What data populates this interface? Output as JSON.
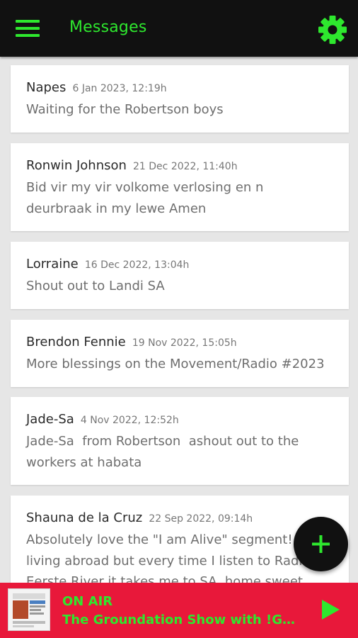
{
  "header": {
    "title": "Messages",
    "menu_icon": "hamburger-menu-icon",
    "settings_icon": "gear-icon",
    "accent_color": "#2ee82e",
    "bar_color": "#111111"
  },
  "messages": [
    {
      "name": "Napes",
      "date": "6 Jan 2023, 12:19h",
      "text": "Waiting for the Robertson boys"
    },
    {
      "name": "Ronwin Johnson",
      "date": "21 Dec 2022, 11:40h",
      "text": "Bid vir my vir volkome verlosing en n\ndeurbraak in my lewe Amen"
    },
    {
      "name": "Lorraine",
      "date": "16 Dec 2022, 13:04h",
      "text": "Shout out to Landi SA"
    },
    {
      "name": "Brendon Fennie",
      "date": "19 Nov 2022, 15:05h",
      "text": "More blessings on the Movement/Radio #2023"
    },
    {
      "name": "Jade-Sa",
      "date": "4 Nov 2022, 12:52h",
      "text": "Jade-Sa  from Robertson  ashout out to the\nworkers at habata"
    },
    {
      "name": "Shauna de la Cruz",
      "date": "22 Sep 2022, 09:14h",
      "text": "Absolutely love the \"I am Alive\" segment! I'm\nliving abroad but every time I listen to Radio\nEerste River it takes me to SA, home sweet"
    }
  ],
  "fab": {
    "icon": "plus-icon"
  },
  "player": {
    "status": "ON AIR",
    "show": "The Groundation Show with !GRADE MALAN",
    "play_icon": "play-icon",
    "background": "#e8183a"
  }
}
